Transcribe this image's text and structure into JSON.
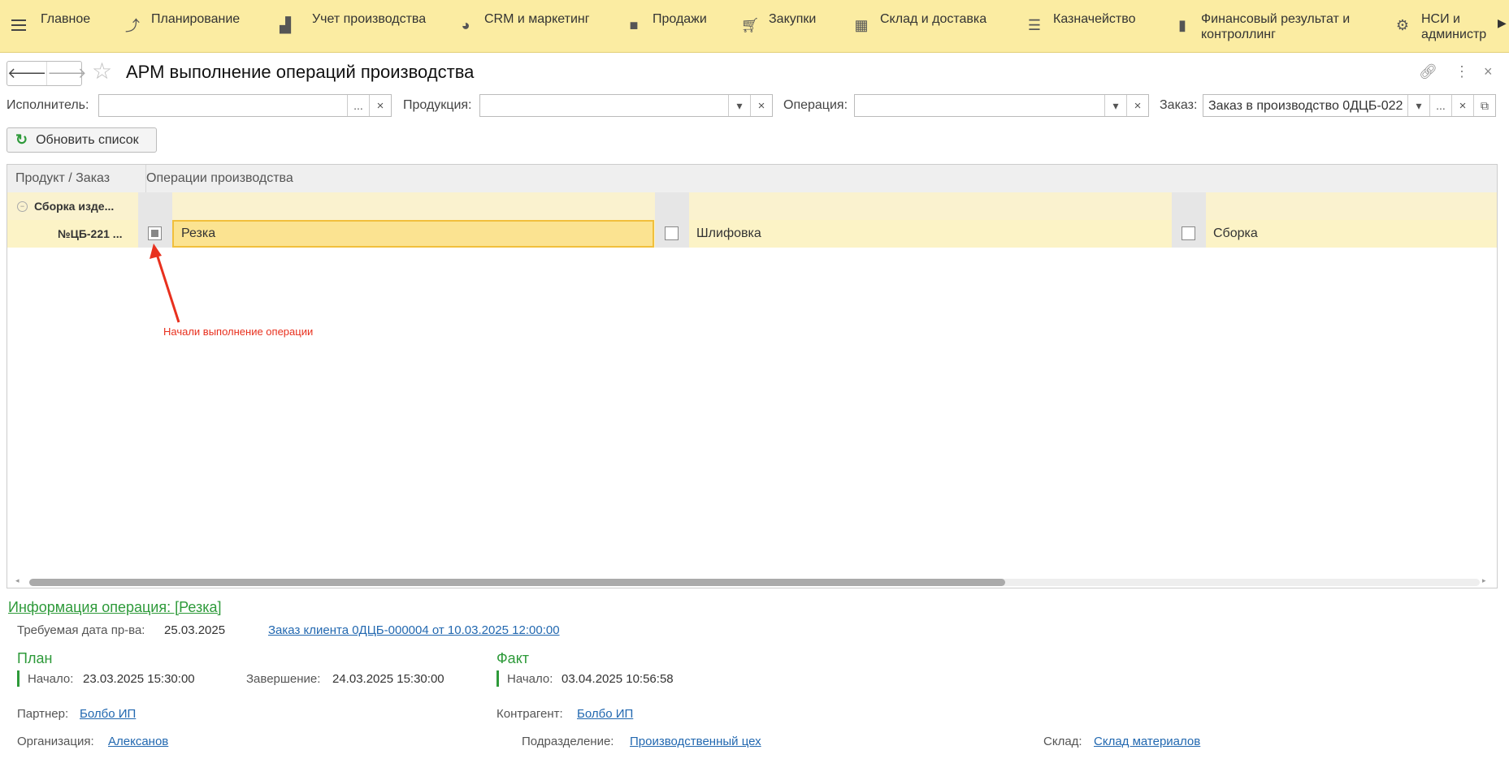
{
  "menu": {
    "items": [
      {
        "label": "Главное",
        "icon": "hamburger-icon"
      },
      {
        "label": "Планирование",
        "icon": "planning-icon"
      },
      {
        "label": "Учет производства",
        "icon": "factory-icon"
      },
      {
        "label": "CRM и маркетинг",
        "icon": "pie-chart-icon"
      },
      {
        "label": "Продажи",
        "icon": "bag-icon"
      },
      {
        "label": "Закупки",
        "icon": "cart-icon"
      },
      {
        "label": "Склад и доставка",
        "icon": "warehouse-icon"
      },
      {
        "label": "Казначейство",
        "icon": "coins-icon"
      },
      {
        "label": "Финансовый результат и",
        "label2": "контроллинг",
        "icon": "bar-chart-icon"
      },
      {
        "label": "НСИ и",
        "label2": "администр",
        "icon": "gear-icon"
      }
    ]
  },
  "header": {
    "title": "АРМ выполнение операций производства"
  },
  "filters": {
    "executor_label": "Исполнитель:",
    "executor_value": "",
    "product_label": "Продукция:",
    "product_value": "",
    "operation_label": "Операция:",
    "operation_value": "",
    "order_label": "Заказ:",
    "order_value": "Заказ в производство 0ДЦБ-022",
    "dots": "...",
    "clear": "×",
    "drop": "▾"
  },
  "refresh_label": "Обновить список",
  "table": {
    "col1": "Продукт / Заказ",
    "col2": "Операции производства",
    "group": "Сборка изде...",
    "order": "№ЦБ-221 ...",
    "operations": [
      {
        "name": "Резка",
        "state": "started"
      },
      {
        "name": "Шлифовка",
        "state": "unchecked"
      },
      {
        "name": "Сборка",
        "state": "unchecked"
      }
    ]
  },
  "annotation": "Начали выполнение операции",
  "scroll": {
    "position": 0.68
  },
  "info": {
    "title": "Информация операция:  [Резка]",
    "required_date_label": "Требуемая дата пр-ва:",
    "required_date": "25.03.2025",
    "client_order_link": "Заказ клиента 0ДЦБ-000004 от 10.03.2025 12:00:00",
    "plan_title": "План",
    "fact_title": "Факт",
    "start_label": "Начало:",
    "plan_start": "23.03.2025 15:30:00",
    "end_label": "Завершение:",
    "plan_end": "24.03.2025 15:30:00",
    "fact_start": "03.04.2025 10:56:58",
    "partner_label": "Партнер:",
    "partner": "Болбо ИП",
    "counterparty_label": "Контрагент:",
    "counterparty": "Болбо ИП",
    "org_label": "Организация:",
    "org": "Алексанов",
    "division_label": "Подразделение:",
    "division": "Производственный цех",
    "warehouse_label": "Склад:",
    "warehouse": "Склад материалов"
  },
  "colors": {
    "menu_bg": "#fbeca2",
    "accent_green": "#2e9a3a",
    "link_blue": "#2268b0",
    "annotation_red": "#e8301e",
    "selection": "#fbe391"
  }
}
